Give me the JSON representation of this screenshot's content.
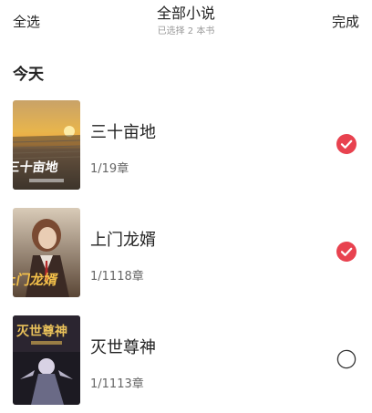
{
  "header": {
    "select_all": "全选",
    "title": "全部小说",
    "subtitle": "已选择 2 本书",
    "done": "完成"
  },
  "section": {
    "title": "今天"
  },
  "books": [
    {
      "title": "三十亩地",
      "progress": "1/19章",
      "selected": true
    },
    {
      "title": "上门龙婿",
      "progress": "1/1118章",
      "selected": true
    },
    {
      "title": "灭世尊神",
      "progress": "1/1113章",
      "selected": false
    }
  ],
  "colors": {
    "accent": "#e8424f",
    "unchecked_ring": "#333333"
  },
  "icons": {
    "checked": "checked-circle-icon",
    "unchecked": "empty-circle-icon"
  }
}
